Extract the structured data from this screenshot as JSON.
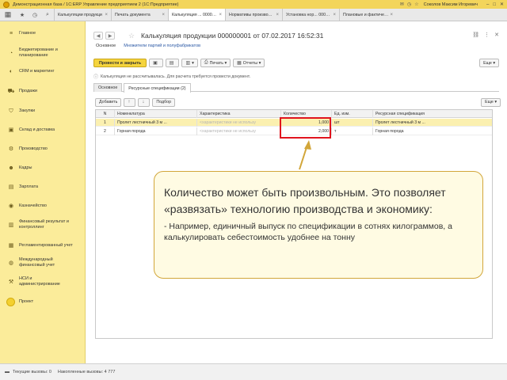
{
  "titlebar": {
    "title": "Демонстрационная база / 1С:ERP Управление предприятием 2 (1С:Предприятие)",
    "user": "Соколов Максим Игоревич"
  },
  "tabs": [
    {
      "label": "Калькуляции продукци"
    },
    {
      "label": "Печать документа"
    },
    {
      "label": "Калькуляция ... 000000001"
    },
    {
      "label": "Нормативы производств..."
    },
    {
      "label": "Установка нор... 000000001"
    },
    {
      "label": "Плановые и фактические..."
    }
  ],
  "sidebar": {
    "items": [
      {
        "label": "Главное",
        "icon": "menu-icon"
      },
      {
        "label": "Бюджетирование и планирование",
        "icon": "budget-icon"
      },
      {
        "label": "CRM и маркетинг",
        "icon": "crm-icon"
      },
      {
        "label": "Продажи",
        "icon": "sales-icon"
      },
      {
        "label": "Закупки",
        "icon": "purchases-icon"
      },
      {
        "label": "Склад и доставка",
        "icon": "warehouse-icon"
      },
      {
        "label": "Производство",
        "icon": "production-icon"
      },
      {
        "label": "Кадры",
        "icon": "personnel-icon"
      },
      {
        "label": "Зарплата",
        "icon": "salary-icon"
      },
      {
        "label": "Казначейство",
        "icon": "treasury-icon"
      },
      {
        "label": "Финансовый результат и контроллинг",
        "icon": "finance-icon"
      },
      {
        "label": "Регламентированный учет",
        "icon": "accounting-icon"
      },
      {
        "label": "Международный финансовый учет",
        "icon": "intl-accounting-icon"
      },
      {
        "label": "НСИ и администрирование",
        "icon": "admin-icon"
      },
      {
        "label": "Проект",
        "icon": "project-icon"
      }
    ]
  },
  "document": {
    "title": "Калькуляция продукции 000000001 от 07.02.2017 16:52:31",
    "nav_main": "Основное",
    "nav_link": "Множители партий и полуфабрикатов",
    "warning": "Калькуляция не рассчитывалась. Для расчета требуется провести документ."
  },
  "toolbar": {
    "post_close": "Провести и закрыть",
    "print": "Печать",
    "reports": "Отчеты",
    "more": "Еще"
  },
  "inner_tabs": [
    "Основное",
    "Ресурсные спецификации (2)"
  ],
  "grid_toolbar": {
    "add": "Добавить",
    "select": "Подбор",
    "more": "Еще"
  },
  "grid": {
    "columns": [
      "N",
      "Номенклатура",
      "Характеристика",
      "Количество",
      "Ед. изм.",
      "Ресурсная спецификация"
    ],
    "rows": [
      {
        "n": "1",
        "nom": "Пролет лестничный 3 м ...",
        "char": "<характеристики не использу",
        "qty": "1,000",
        "unit": "шт",
        "spec": "Пролет лестничный 3 м ..."
      },
      {
        "n": "2",
        "nom": "Горная порода",
        "char": "<характеристики не использу",
        "qty": "2,000",
        "unit": "т",
        "spec": "Горная порода"
      }
    ]
  },
  "callout": {
    "main": "Количество может быть произвольным. Это позволяет «развязать» технологию производства и экономику:",
    "sub": "- Например, единичный выпуск по спецификации в сотнях килограммов, а калькулировать себестоимость удобнее на тонну"
  },
  "statusbar": {
    "current_calls": "Текущие вызовы: 0",
    "accumulated_calls": "Накопленные вызовы: 4 777"
  },
  "colors": {
    "accent_yellow": "#f5d43d",
    "sidebar_bg": "#fbec9a",
    "highlight_red": "#e0141e",
    "callout_border": "#d2a63a",
    "callout_bg": "#fffbe3"
  }
}
